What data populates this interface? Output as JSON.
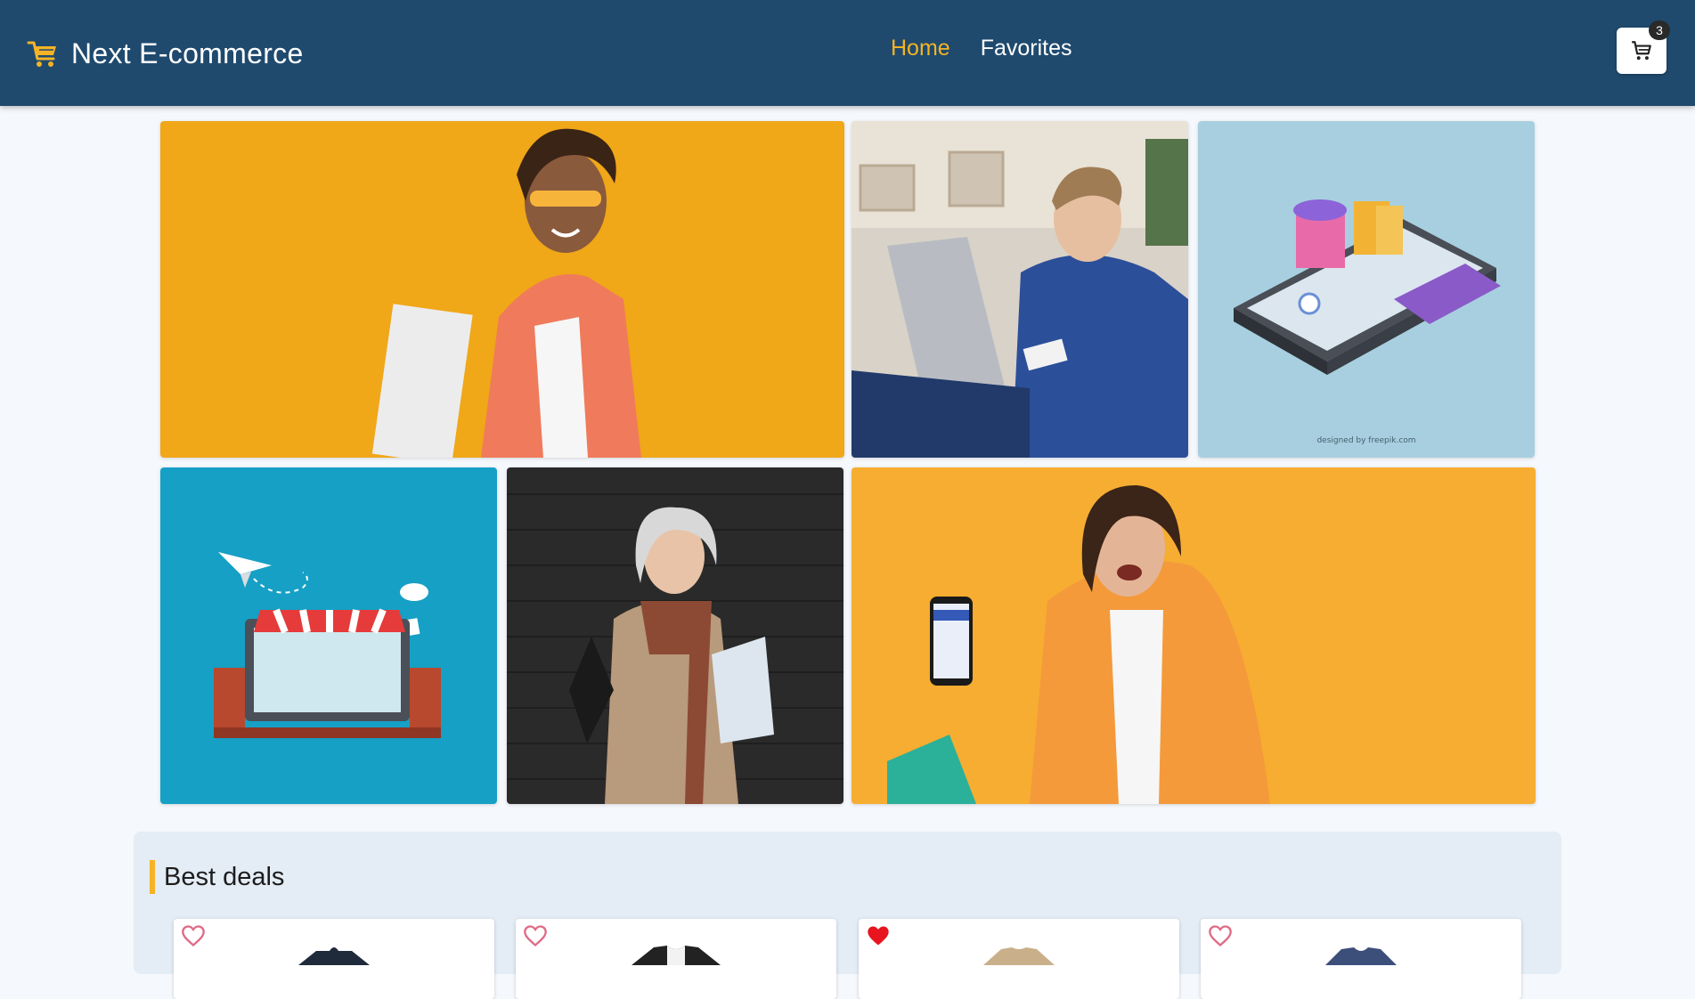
{
  "header": {
    "brand_name": "Next E-commerce",
    "brand_icon": "shopping-cart-icon",
    "nav": [
      {
        "label": "Home",
        "active": true
      },
      {
        "label": "Favorites",
        "active": false
      }
    ],
    "cart_count": "3",
    "cart_icon": "cart-icon"
  },
  "colors": {
    "header_bg": "#1f4a6e",
    "accent": "#f5b325",
    "favorite_active": "#e8141e",
    "favorite_inactive": "#e06a86"
  },
  "hero": {
    "tiles": [
      {
        "name": "woman-shopping-bags-yellow"
      },
      {
        "name": "man-laptop-credit-card"
      },
      {
        "name": "isometric-phone-shopping"
      },
      {
        "name": "online-store-laptop-illustration"
      },
      {
        "name": "senior-woman-shopping-bag"
      },
      {
        "name": "woman-smartphone-orange"
      }
    ],
    "freepik_credit": "designed by freepik.com"
  },
  "deals": {
    "title": "Best deals",
    "products": [
      {
        "favorite": false
      },
      {
        "favorite": false
      },
      {
        "favorite": true
      },
      {
        "favorite": false
      }
    ]
  }
}
